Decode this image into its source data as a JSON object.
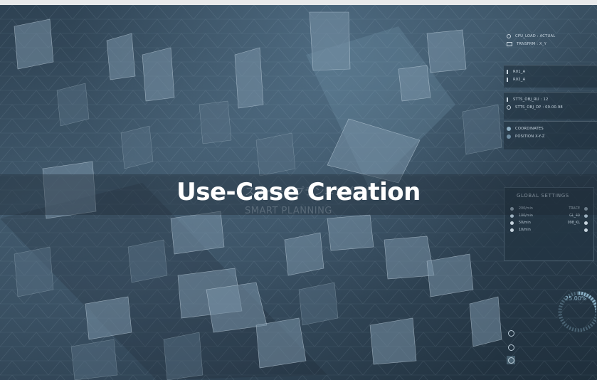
{
  "title": "Use-Case Creation",
  "overlay": {
    "japanese": "スマート・プランニング",
    "english": "SMART PLANNING"
  },
  "hud": {
    "cpu_load": "CPU_LOAD : ACTUAL",
    "transform": "TRNSFRM : X_Y",
    "r01": "R01_A",
    "r02": "R02_A",
    "stts_ru": "STTS_OBJ_RU : 12",
    "stts_dp": "STTS_OBJ_DP : 09.00.98",
    "coordinates": "COORDINATES",
    "position": "POSITION X-Y-Z"
  },
  "global_settings": {
    "title": "GLOBAL SETTINGS",
    "rows": [
      {
        "left": "200/min",
        "right": "TRACE"
      },
      {
        "left": "100/min",
        "right": "GL_49"
      },
      {
        "left": "50/min",
        "right": "098_KL"
      },
      {
        "left": "10/min",
        "right": ""
      }
    ]
  },
  "gauge": {
    "percent": "25.00%"
  },
  "colors": {
    "accent": "#8fb0c4",
    "panel": "#23344a"
  }
}
